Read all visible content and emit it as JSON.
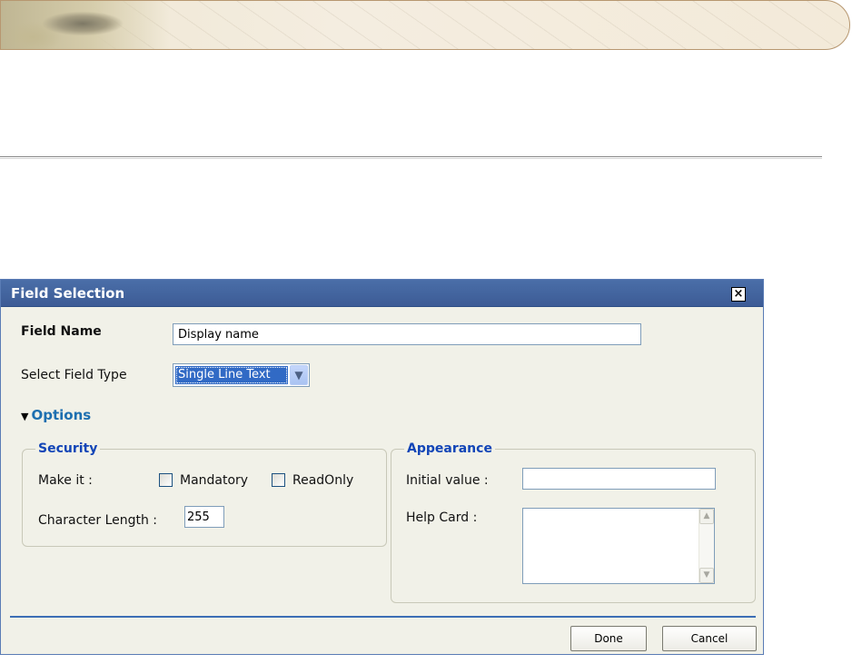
{
  "dialog": {
    "title": "Field Selection",
    "close_icon": "close-icon",
    "field_name": {
      "label": "Field Name",
      "value": "Display name"
    },
    "field_type": {
      "label": "Select Field Type",
      "value": "Single Line Text"
    },
    "options_toggle": "Options",
    "security": {
      "legend": "Security",
      "make_it_label": "Make it :",
      "mandatory_label": "Mandatory",
      "readonly_label": "ReadOnly",
      "char_length_label": "Character Length :",
      "char_length_value": "255"
    },
    "appearance": {
      "legend": "Appearance",
      "initial_value_label": "Initial value :",
      "initial_value": "",
      "help_card_label": "Help Card :"
    },
    "buttons": {
      "done": "Done",
      "cancel": "Cancel"
    }
  }
}
